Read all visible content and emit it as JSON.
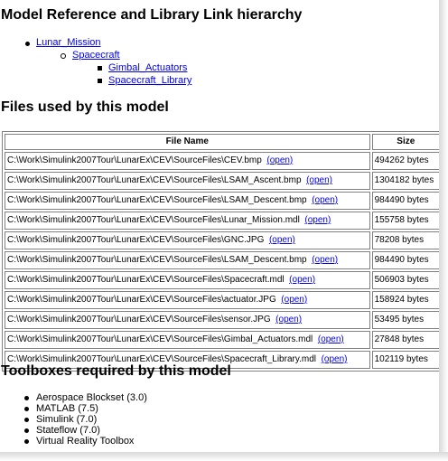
{
  "sections": {
    "hierarchy_heading": "Model Reference and Library Link hierarchy",
    "files_heading": "Files used by this model",
    "toolboxes_heading": "Toolboxes required by this model"
  },
  "hierarchy": {
    "root": "Lunar_Mission",
    "child": "Spacecraft",
    "grandchildren": [
      "Gimbal_Actuators",
      "Spacecraft_Library"
    ]
  },
  "files_table": {
    "headers": [
      "File Name",
      "Size"
    ],
    "open_label": "(open)",
    "rows": [
      {
        "path": "C:\\Work\\Simulink2007Tour\\LunarEx\\CEV\\SourceFiles\\CEV.bmp",
        "size": "494262 bytes"
      },
      {
        "path": "C:\\Work\\Simulink2007Tour\\LunarEx\\CEV\\SourceFiles\\LSAM_Ascent.bmp",
        "size": "1304182 bytes"
      },
      {
        "path": "C:\\Work\\Simulink2007Tour\\LunarEx\\CEV\\SourceFiles\\LSAM_Descent.bmp",
        "size": "984490 bytes"
      },
      {
        "path": "C:\\Work\\Simulink2007Tour\\LunarEx\\CEV\\SourceFiles\\Lunar_Mission.mdl",
        "size": "155758 bytes"
      },
      {
        "path": "C:\\Work\\Simulink2007Tour\\LunarEx\\CEV\\SourceFiles\\GNC.JPG",
        "size": "78208 bytes"
      },
      {
        "path": "C:\\Work\\Simulink2007Tour\\LunarEx\\CEV\\SourceFiles\\LSAM_Descent.bmp",
        "size": "984490 bytes"
      },
      {
        "path": "C:\\Work\\Simulink2007Tour\\LunarEx\\CEV\\SourceFiles\\Spacecraft.mdl",
        "size": "506903 bytes"
      },
      {
        "path": "C:\\Work\\Simulink2007Tour\\LunarEx\\CEV\\SourceFiles\\actuator.JPG",
        "size": "158924 bytes"
      },
      {
        "path": "C:\\Work\\Simulink2007Tour\\LunarEx\\CEV\\SourceFiles\\sensor.JPG",
        "size": "53495 bytes"
      },
      {
        "path": "C:\\Work\\Simulink2007Tour\\LunarEx\\CEV\\SourceFiles\\Gimbal_Actuators.mdl",
        "size": "27848 bytes"
      },
      {
        "path": "C:\\Work\\Simulink2007Tour\\LunarEx\\CEV\\SourceFiles\\Spacecraft_Library.mdl",
        "size": "102119 bytes"
      }
    ]
  },
  "toolboxes": [
    "Aerospace Blockset (3.0)",
    "MATLAB (7.5)",
    "Simulink (7.0)",
    "Stateflow (7.0)",
    "Virtual Reality Toolbox"
  ]
}
